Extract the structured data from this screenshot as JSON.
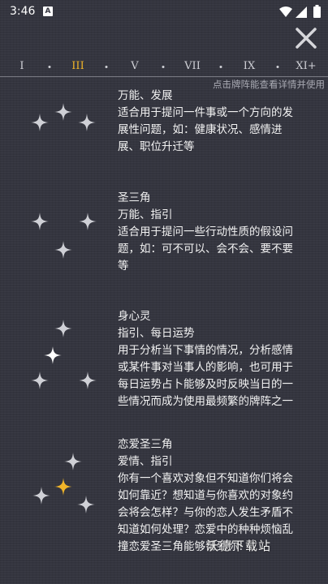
{
  "status": {
    "time": "3:46",
    "notification_badge": "A"
  },
  "nav": {
    "numerals": [
      "I",
      "III",
      "V",
      "VII",
      "IX",
      "XI+"
    ],
    "active_index": 1,
    "hint": "点击牌阵能查看详情并使用"
  },
  "spreads": [
    {
      "title": "万能、发展",
      "lines": [
        "适合用于提问一件事或一个方向的发",
        "展性问题，如：健康状况、感情进",
        "展、职位升迁等"
      ]
    },
    {
      "name": "圣三角",
      "title": "万能、指引",
      "lines": [
        "适合用于提问一些行动性质的假设问",
        "题，如：可不可以、会不会、要不要",
        "等"
      ]
    },
    {
      "name": "身心灵",
      "title": "指引、每日运势",
      "lines": [
        "用于分析当下事情的情况，分析感情",
        "或某件事对当事人的影响，也可用于",
        "每日运势占卜能够及时反映当日的一",
        "些情况而成为使用最频繁的牌阵之一"
      ]
    },
    {
      "name": "恋爱圣三角",
      "title": "爱情、指引",
      "lines": [
        "你有一个喜欢对象但不知道你们将会",
        "如何靠近？想知道与你喜欢的对象约",
        "会将会怎样？与你的恋人发生矛盾不",
        "知道如何处理？恋爱中的种种烦恼乱",
        "撞恋爱圣三角能够帮到你！"
      ]
    }
  ],
  "watermark": "沃德下载站",
  "colors": {
    "accent": "#f0b429",
    "background": "#34353f",
    "star": "#cfd0d6"
  }
}
